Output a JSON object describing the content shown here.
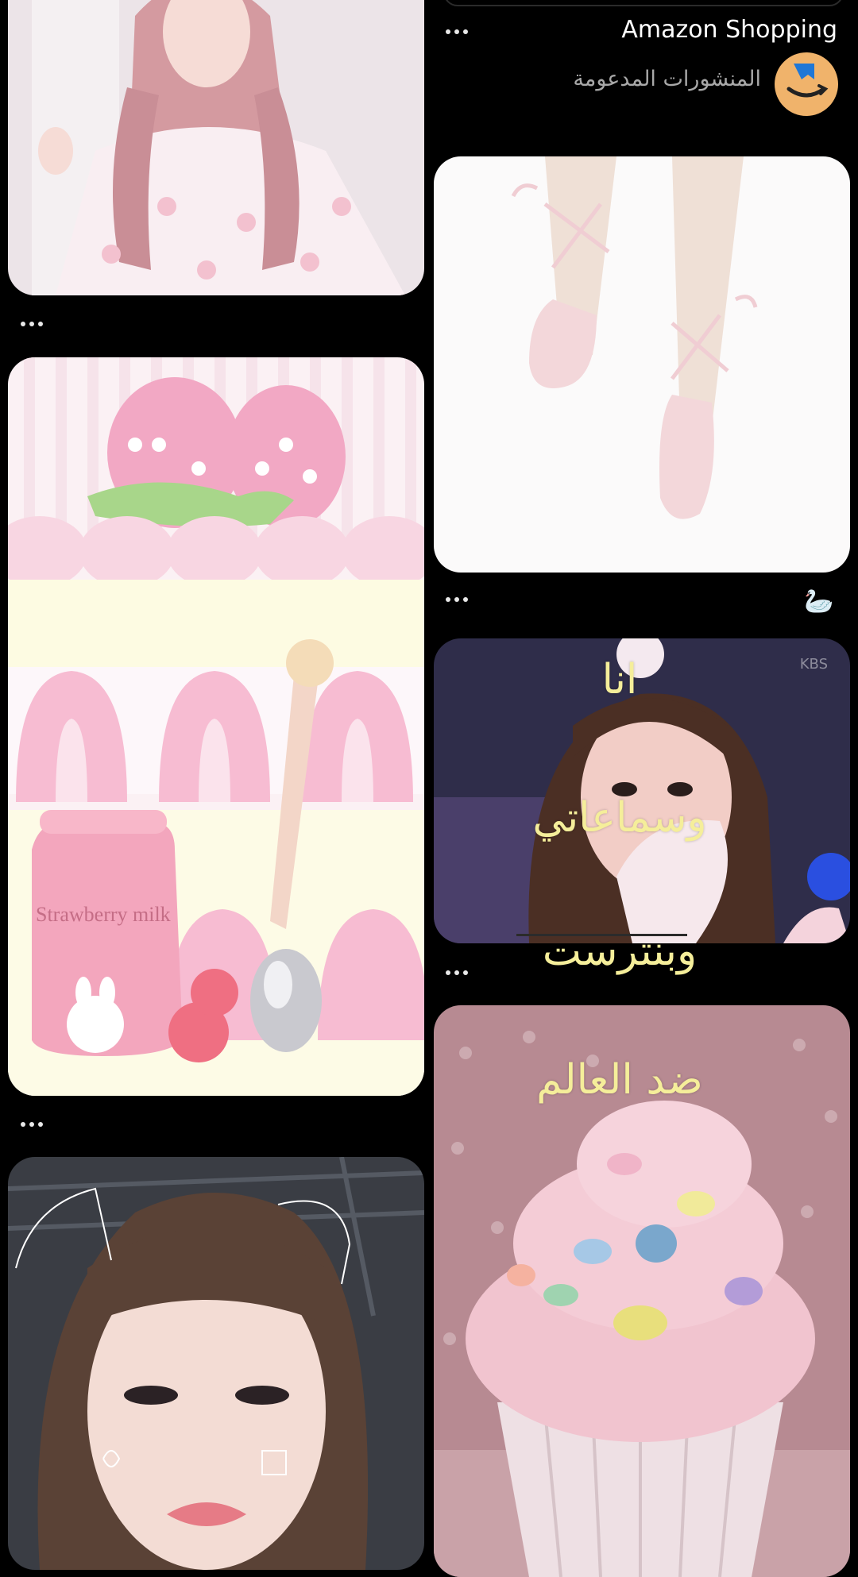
{
  "sponsored": {
    "brand": "Amazon Shopping",
    "label": "المنشورات المدعومة"
  },
  "pins": [
    {
      "id": "pin-pajama-girl",
      "caption": ""
    },
    {
      "id": "pin-strawberry-milk",
      "caption": ""
    },
    {
      "id": "pin-cat-face-girl",
      "caption": ""
    },
    {
      "id": "pin-ballet-shoes",
      "caption": "🦢"
    },
    {
      "id": "pin-bunny-girl",
      "caption": "",
      "watermark": "KBS"
    },
    {
      "id": "pin-cupcake",
      "caption": ""
    }
  ],
  "overlay_lines": [
    "انا",
    "وسماعاتي",
    "وبنترست",
    "ضد العالم"
  ],
  "bottle_text": "Strawberry milk",
  "colors": {
    "background": "#000000",
    "overlay_text": "#f5ee9a",
    "amazon_orange": "#f0b36b"
  }
}
